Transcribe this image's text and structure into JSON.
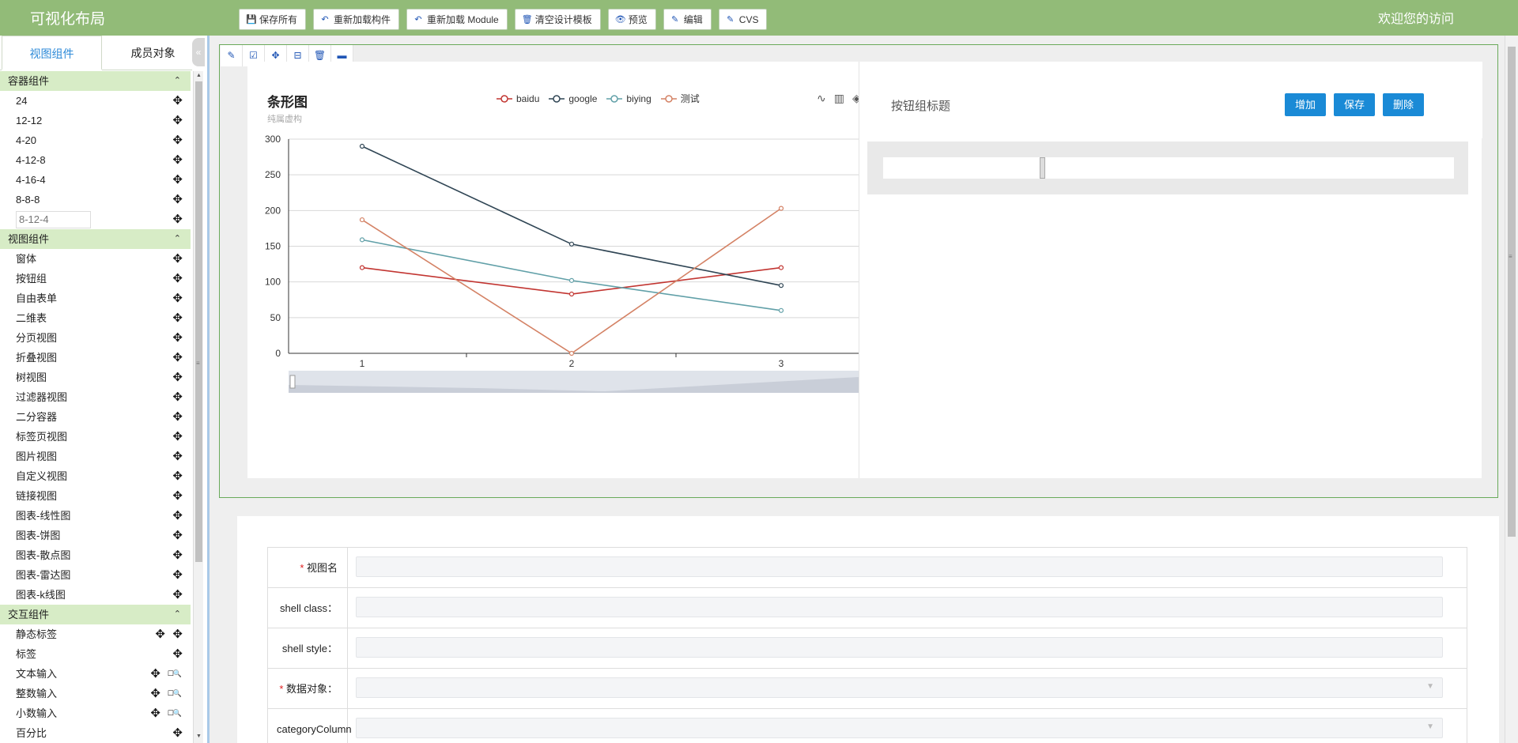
{
  "app": {
    "title": "可视化布局",
    "welcome": "欢迎您的访问"
  },
  "toolbar": [
    {
      "label": "保存所有",
      "icon": "save-icon"
    },
    {
      "label": "重新加载构件",
      "icon": "reply-icon"
    },
    {
      "label": "重新加载 Module",
      "icon": "reply-icon"
    },
    {
      "label": "清空设计模板",
      "icon": "trash-icon"
    },
    {
      "label": "预览",
      "icon": "eye-icon"
    },
    {
      "label": "编辑",
      "icon": "edit-icon"
    },
    {
      "label": "CVS",
      "icon": "edit-icon"
    }
  ],
  "sidebar": {
    "tabs": [
      "视图组件",
      "成员对象"
    ],
    "groups": [
      {
        "title": "容器组件",
        "items": [
          "24",
          "12-12",
          "4-20",
          "4-12-8",
          "4-16-4",
          "8-8-8"
        ],
        "input_placeholder": "8-12-4"
      },
      {
        "title": "视图组件",
        "items": [
          "窗体",
          "按钮组",
          "自由表单",
          "二维表",
          "分页视图",
          "折叠视图",
          "树视图",
          "过滤器视图",
          "二分容器",
          "标签页视图",
          "图片视图",
          "自定义视图",
          "链接视图",
          "图表-线性图",
          "图表-饼图",
          "图表-散点图",
          "图表-雷达图",
          "图表-k线图"
        ]
      },
      {
        "title": "交互组件",
        "items": [
          "静态标签",
          "标签",
          "文本输入",
          "整数输入",
          "小数输入",
          "百分比"
        ]
      }
    ]
  },
  "chart_data": {
    "type": "line",
    "title": "条形图",
    "subtitle": "纯属虚构",
    "categories": [
      "1",
      "2",
      "3"
    ],
    "ylim": [
      0,
      300
    ],
    "yticks": [
      0,
      50,
      100,
      150,
      200,
      250,
      300
    ],
    "grid": true,
    "legend_position": "top",
    "series": [
      {
        "name": "baidu",
        "values": [
          120,
          83,
          120
        ],
        "color": "#c23531"
      },
      {
        "name": "google",
        "values": [
          290,
          153,
          95
        ],
        "color": "#2f4554"
      },
      {
        "name": "biying",
        "values": [
          159,
          102,
          60
        ],
        "color": "#61a0a8"
      },
      {
        "name": "测试",
        "values": [
          187,
          0,
          203
        ],
        "color": "#d48265"
      }
    ]
  },
  "button_group": {
    "title": "按钮组标题",
    "buttons": [
      "增加",
      "保存",
      "删除"
    ]
  },
  "form": {
    "rows": [
      {
        "label": "视图名",
        "required": true,
        "select": false
      },
      {
        "label": "shell class：",
        "required": false,
        "select": false
      },
      {
        "label": "shell style：",
        "required": false,
        "select": false
      },
      {
        "label": "数据对象：",
        "required": true,
        "select": true
      },
      {
        "label": "categoryColumn",
        "required": false,
        "select": true
      }
    ]
  }
}
